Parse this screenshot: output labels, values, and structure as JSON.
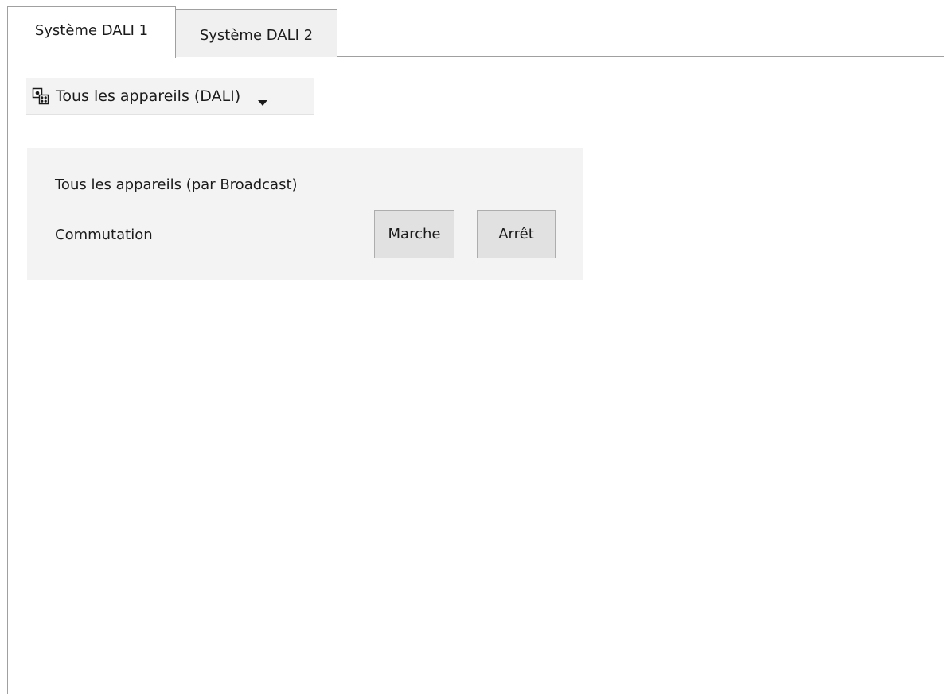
{
  "tabs": [
    {
      "label": "Système DALI 1",
      "active": true
    },
    {
      "label": "Système DALI 2",
      "active": false
    }
  ],
  "device_selector": {
    "icon": "devices-group-icon",
    "selected": "Tous les appareils (DALI)"
  },
  "broadcast_panel": {
    "title": "Tous les appareils (par Broadcast)",
    "switching_label": "Commutation",
    "on_label": "Marche",
    "off_label": "Arrêt"
  }
}
